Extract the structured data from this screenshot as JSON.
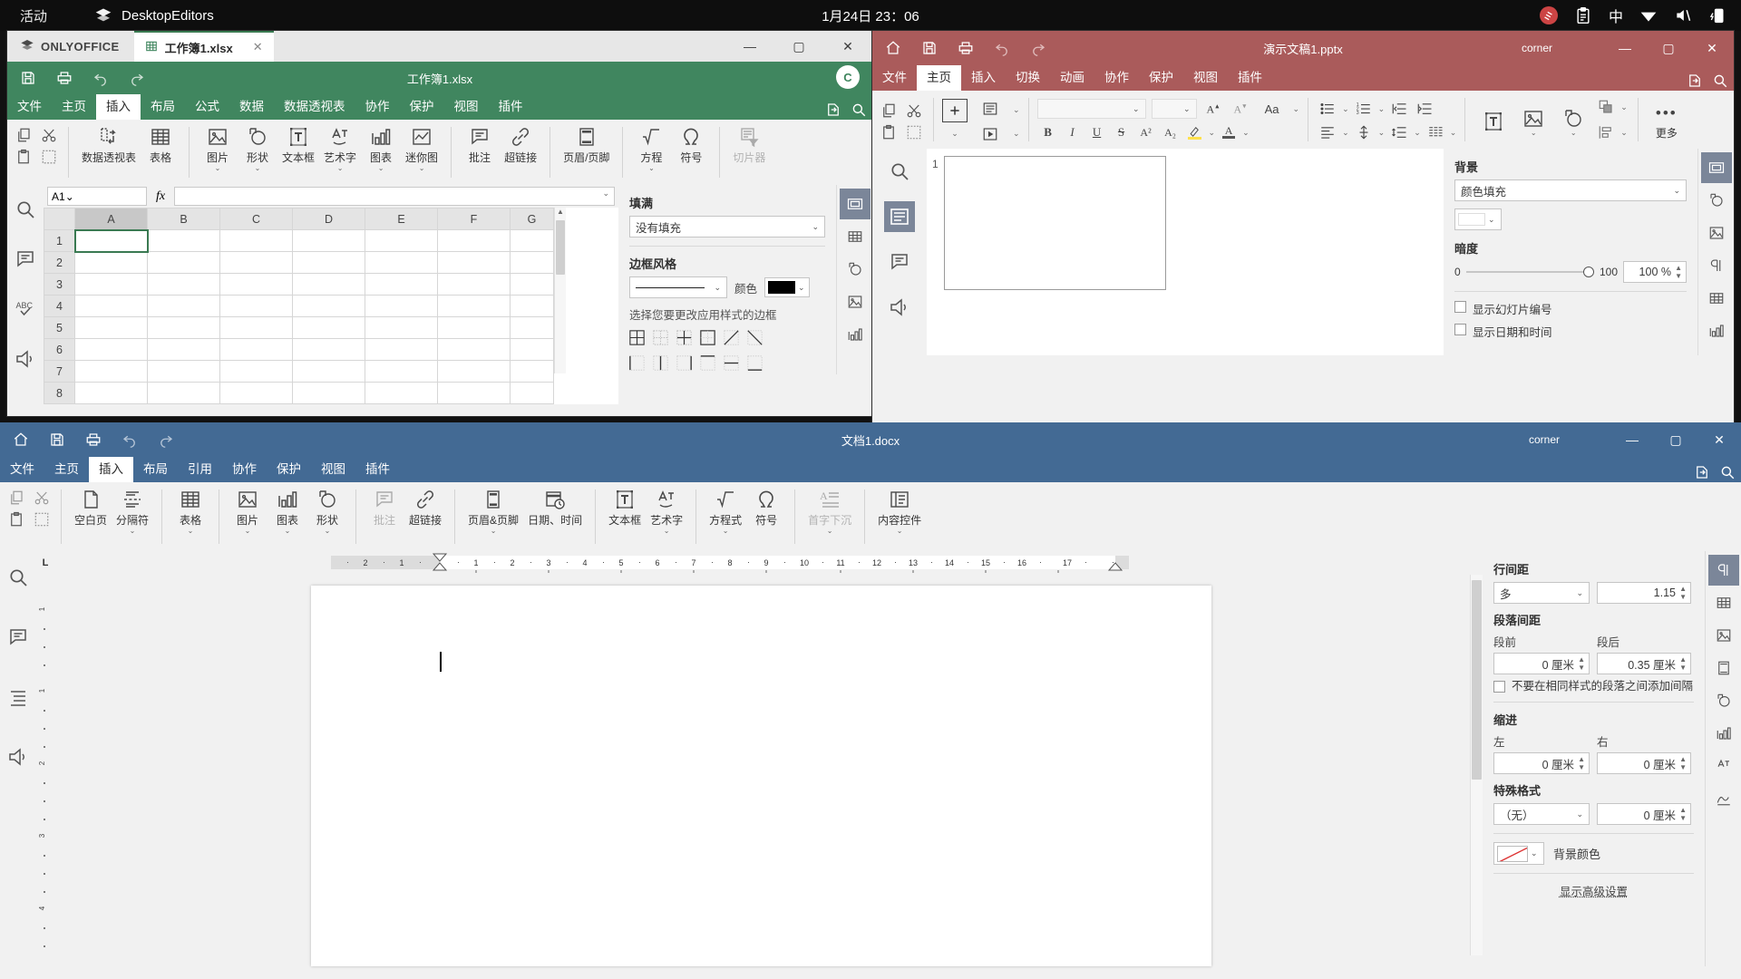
{
  "topbar": {
    "activities": "活动",
    "app_name": "DesktopEditors",
    "clock": "1月24日 23：06",
    "icons": [
      "record-icon",
      "clipboard-icon",
      "input-method-icon",
      "wifi-icon",
      "volume-muted-icon",
      "battery-icon"
    ],
    "input_method": "中"
  },
  "spreadsheet": {
    "brand": "ONLYOFFICE",
    "tab_label": "工作簿1.xlsx",
    "tab_close": "✕",
    "doc_title": "工作簿1.xlsx",
    "avatar_initial": "C",
    "window_buttons": {
      "minimize": "—",
      "maximize": "▢",
      "close": "✕"
    },
    "quick_icons": [
      "save-icon",
      "print-icon",
      "undo-icon",
      "redo-icon"
    ],
    "menu": [
      "文件",
      "主页",
      "插入",
      "布局",
      "公式",
      "数据",
      "数据透视表",
      "协作",
      "保护",
      "视图",
      "插件"
    ],
    "menu_active": "插入",
    "menu_right_icons": [
      "open-file-location-icon",
      "search-icon"
    ],
    "ribbon": [
      {
        "label": "数据透视表",
        "icon": "pivot-table-icon"
      },
      {
        "label": "表格",
        "icon": "table-icon"
      },
      {
        "label": "图片",
        "icon": "image-icon",
        "caret": true
      },
      {
        "label": "形状",
        "icon": "shape-icon",
        "caret": true
      },
      {
        "label": "文本框",
        "icon": "textbox-icon"
      },
      {
        "label": "艺术字",
        "icon": "wordart-icon",
        "caret": true
      },
      {
        "label": "图表",
        "icon": "chart-icon",
        "caret": true
      },
      {
        "label": "迷你图",
        "icon": "sparkline-icon",
        "caret": true
      },
      {
        "label": "批注",
        "icon": "comment-icon"
      },
      {
        "label": "超链接",
        "icon": "hyperlink-icon"
      },
      {
        "label": "页眉/页脚",
        "icon": "header-footer-icon"
      },
      {
        "label": "方程",
        "icon": "equation-icon",
        "caret": true
      },
      {
        "label": "符号",
        "icon": "symbol-icon"
      },
      {
        "label": "切片器",
        "icon": "slicer-icon",
        "disabled": true
      }
    ],
    "formula_bar": {
      "name_box": "A1",
      "fx": "fx",
      "formula": ""
    },
    "grid": {
      "columns": [
        "A",
        "B",
        "C",
        "D",
        "E",
        "F",
        "G"
      ],
      "rows": [
        "1",
        "2",
        "3",
        "4",
        "5",
        "6",
        "7",
        "8"
      ],
      "selected_cell": "A1",
      "selected_column": "A",
      "selected_row": "1"
    },
    "left_rail_icons": [
      "search-icon",
      "comment-icon",
      "spellcheck-icon",
      "feedback-icon"
    ],
    "panel": {
      "fill_title": "填满",
      "fill_value": "没有填充",
      "border_title": "边框风格",
      "border_color_label": "颜色",
      "border_color": "#000000",
      "border_hint": "选择您要更改应用样式的边框",
      "border_buttons_row1": [
        "all-borders-icon",
        "inner-borders-icon",
        "inner-cross-icon",
        "outer-box-icon",
        "diagonal-up-icon",
        "diagonal-down-icon"
      ],
      "border_buttons_row2": [
        "left-border-icon",
        "inner-vertical-icon",
        "right-border-icon",
        "top-border-icon",
        "inner-horizontal-icon",
        "bottom-border-icon"
      ]
    },
    "right_rail_icons": [
      "cell-settings-icon",
      "table-settings-icon",
      "shape-settings-icon",
      "image-settings-icon",
      "chart-settings-icon"
    ],
    "right_rail_selected": "cell-settings-icon"
  },
  "presentation": {
    "doc_title": "演示文稿1.pptx",
    "username": "corner",
    "window_buttons": {
      "minimize": "—",
      "maximize": "▢",
      "close": "✕"
    },
    "quick_icons": [
      "home-icon",
      "save-icon",
      "print-icon",
      "undo-icon",
      "redo-icon"
    ],
    "menu": [
      "文件",
      "主页",
      "插入",
      "切换",
      "动画",
      "协作",
      "保护",
      "视图",
      "插件"
    ],
    "menu_active": "主页",
    "menu_right_icons": [
      "open-file-location-icon",
      "search-icon"
    ],
    "ribbon_more_label": "更多",
    "font_name": "",
    "font_size": "",
    "slide_number": "1",
    "left_rail_icons": [
      "search-icon",
      "slide-icon",
      "comment-icon",
      "feedback-icon"
    ],
    "panel": {
      "background_title": "背景",
      "background_value": "颜色填充",
      "background_color": "#ffffff",
      "opacity_title": "暗度",
      "opacity_min": "0",
      "opacity_max": "100",
      "opacity_value": "100 %",
      "show_slide_number": "显示幻灯片编号",
      "show_date_time": "显示日期和时间"
    },
    "right_rail_icons": [
      "slide-settings-icon",
      "shape-settings-icon",
      "image-settings-icon",
      "paragraph-settings-icon",
      "table-settings-icon",
      "chart-settings-icon"
    ],
    "right_rail_selected": "slide-settings-icon"
  },
  "document": {
    "doc_title": "文档1.docx",
    "username": "corner",
    "window_buttons": {
      "minimize": "—",
      "maximize": "▢",
      "close": "✕"
    },
    "quick_icons": [
      "home-icon",
      "save-icon",
      "print-icon",
      "undo-icon",
      "redo-icon"
    ],
    "menu": [
      "文件",
      "主页",
      "插入",
      "布局",
      "引用",
      "协作",
      "保护",
      "视图",
      "插件"
    ],
    "menu_active": "插入",
    "menu_right_icons": [
      "open-file-location-icon",
      "search-icon"
    ],
    "ribbon": [
      {
        "label": "空白页",
        "icon": "blank-page-icon"
      },
      {
        "label": "分隔符",
        "icon": "break-icon",
        "caret": true
      },
      {
        "label": "表格",
        "icon": "table-icon",
        "caret": true
      },
      {
        "label": "图片",
        "icon": "image-icon",
        "caret": true
      },
      {
        "label": "图表",
        "icon": "chart-icon",
        "caret": true
      },
      {
        "label": "形状",
        "icon": "shape-icon",
        "caret": true
      },
      {
        "label": "批注",
        "icon": "comment-icon",
        "disabled": true
      },
      {
        "label": "超链接",
        "icon": "hyperlink-icon"
      },
      {
        "label": "页眉&页脚",
        "icon": "header-footer-icon",
        "caret": true
      },
      {
        "label": "日期、时间",
        "icon": "date-time-icon"
      },
      {
        "label": "文本框",
        "icon": "textbox-icon"
      },
      {
        "label": "艺术字",
        "icon": "wordart-icon",
        "caret": true
      },
      {
        "label": "方程式",
        "icon": "equation-icon",
        "caret": true
      },
      {
        "label": "符号",
        "icon": "symbol-icon"
      },
      {
        "label": "首字下沉",
        "icon": "dropcap-icon",
        "caret": true,
        "disabled": true
      },
      {
        "label": "内容控件",
        "icon": "content-control-icon",
        "caret": true
      }
    ],
    "ruler": {
      "tab_stop": "L",
      "negative_ticks": [
        "2",
        "1"
      ],
      "ticks": [
        "1",
        "2",
        "3",
        "4",
        "5",
        "6",
        "7",
        "8",
        "9",
        "10",
        "11",
        "12",
        "13",
        "14",
        "15",
        "16",
        "17"
      ]
    },
    "left_rail_icons": [
      "search-icon",
      "comment-icon",
      "headings-icon",
      "feedback-icon"
    ],
    "panel": {
      "line_spacing_title": "行间距",
      "line_spacing_rule": "多",
      "line_spacing_value": "1.15",
      "para_spacing_title": "段落间距",
      "before_label": "段前",
      "before_value": "0 厘米",
      "after_label": "段后",
      "after_value": "0.35 厘米",
      "no_space_same_style": "不要在相同样式的段落之间添加间隔",
      "indent_title": "缩进",
      "left_label": "左",
      "left_value": "0 厘米",
      "right_label": "右",
      "right_value": "0 厘米",
      "special_title": "特殊格式",
      "special_value": "（无）",
      "special_by_value": "0 厘米",
      "bg_color_label": "背景颜色",
      "bg_color": "none",
      "advanced_link": "显示高级设置"
    },
    "right_rail_icons": [
      "paragraph-settings-icon",
      "table-settings-icon",
      "image-settings-icon",
      "header-footer-settings-icon",
      "shape-settings-icon",
      "chart-settings-icon",
      "textart-settings-icon",
      "signature-icon"
    ],
    "right_rail_selected": "paragraph-settings-icon"
  },
  "colors": {
    "spreadsheet_accent": "#40865f",
    "presentation_accent": "#aa5b5b",
    "document_accent": "#436a94",
    "topbar_bg": "#0e0e0e",
    "panel_bg": "#f1f1f1"
  }
}
